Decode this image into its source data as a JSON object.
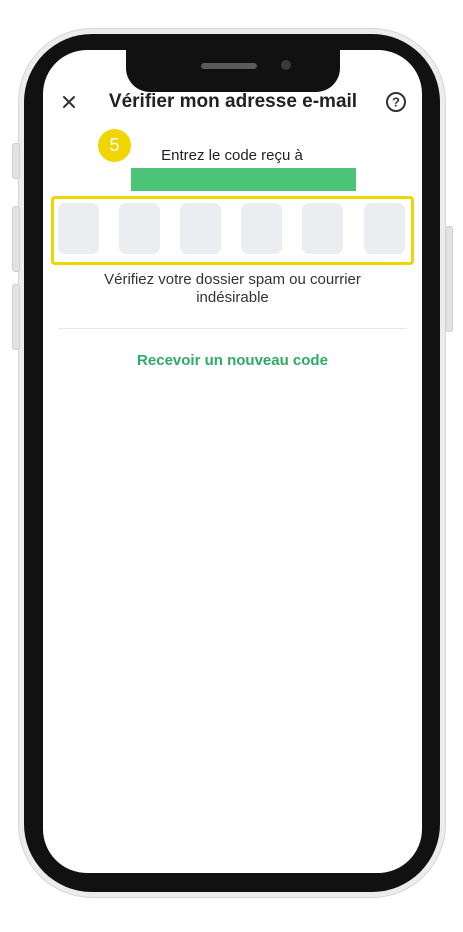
{
  "header": {
    "title": "Vérifier mon adresse e-mail",
    "close_icon": "close-icon",
    "help_icon": "help-circle-icon",
    "close_glyph": "✕",
    "help_glyph": "?"
  },
  "step_badge": "5",
  "verify": {
    "instruction": "Entrez le code reçu à",
    "code_length": 6,
    "spam_hint": "Vérifiez votre dossier spam ou courrier indésirable",
    "resend_label": "Recevoir un nouveau code"
  },
  "colors": {
    "accent_green": "#2eaa66",
    "redaction_green": "#4cc477",
    "highlight_yellow": "#f0d500",
    "code_cell_bg": "#ebedf0"
  }
}
